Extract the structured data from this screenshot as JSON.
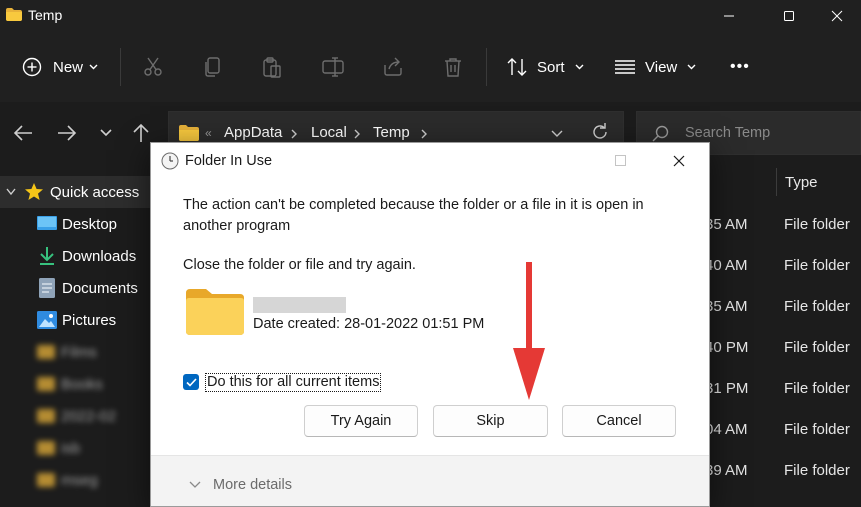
{
  "window": {
    "title": "Temp"
  },
  "commandbar": {
    "new_label": "New",
    "sort_label": "Sort",
    "view_label": "View",
    "more_label": "•••"
  },
  "address": {
    "crumbs": [
      "AppData",
      "Local",
      "Temp"
    ],
    "search_placeholder": "Search Temp"
  },
  "sidebar": {
    "quick_access": "Quick access",
    "items": [
      {
        "label": "Desktop",
        "icon": "desktop-icon"
      },
      {
        "label": "Downloads",
        "icon": "download-icon"
      },
      {
        "label": "Documents",
        "icon": "documents-icon"
      },
      {
        "label": "Pictures",
        "icon": "pictures-icon"
      }
    ],
    "blurred_items": [
      "Films",
      "Books",
      "2022-02",
      "isb",
      "mseg"
    ]
  },
  "filelist": {
    "type_header": "Type",
    "rows": [
      {
        "time": "35 AM",
        "type": "File folder"
      },
      {
        "time": "40 AM",
        "type": "File folder"
      },
      {
        "time": "35 AM",
        "type": "File folder"
      },
      {
        "time": "40 PM",
        "type": "File folder"
      },
      {
        "time": "31 PM",
        "type": "File folder"
      },
      {
        "time": "04 AM",
        "type": "File folder"
      },
      {
        "time": "39 AM",
        "type": "File folder"
      }
    ]
  },
  "dialog": {
    "title": "Folder In Use",
    "message": "The action can't be completed because the folder or a file in it is open in another program",
    "instruction": "Close the folder or file and try again.",
    "date_created": "Date created: 28-01-2022 01:51 PM",
    "checkbox_label": "Do this for all current items",
    "checkbox_checked": true,
    "buttons": {
      "try_again": "Try Again",
      "skip": "Skip",
      "cancel": "Cancel"
    },
    "more_details": "More details"
  },
  "colors": {
    "accent": "#0067c0",
    "folder": "#f8c93e",
    "annotation_arrow": "#e53935"
  }
}
